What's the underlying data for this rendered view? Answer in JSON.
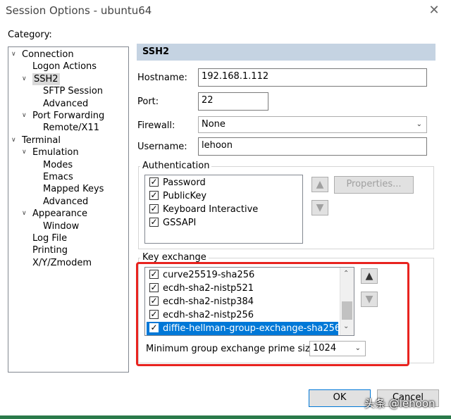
{
  "window": {
    "title": "Session Options - ubuntu64",
    "close_glyph": "✕"
  },
  "category": {
    "label": "Category:",
    "items": [
      {
        "label": "Connection",
        "level": 0,
        "expanded": true
      },
      {
        "label": "Logon Actions",
        "level": 1
      },
      {
        "label": "SSH2",
        "level": 1,
        "expanded": true,
        "selected": true
      },
      {
        "label": "SFTP Session",
        "level": 2
      },
      {
        "label": "Advanced",
        "level": 2
      },
      {
        "label": "Port Forwarding",
        "level": 1,
        "expanded": true
      },
      {
        "label": "Remote/X11",
        "level": 2
      },
      {
        "label": "Terminal",
        "level": 0,
        "expanded": true
      },
      {
        "label": "Emulation",
        "level": 1,
        "expanded": true
      },
      {
        "label": "Modes",
        "level": 2
      },
      {
        "label": "Emacs",
        "level": 2
      },
      {
        "label": "Mapped Keys",
        "level": 2
      },
      {
        "label": "Advanced",
        "level": 2
      },
      {
        "label": "Appearance",
        "level": 1,
        "expanded": true
      },
      {
        "label": "Window",
        "level": 2
      },
      {
        "label": "Log File",
        "level": 1
      },
      {
        "label": "Printing",
        "level": 1
      },
      {
        "label": "X/Y/Zmodem",
        "level": 1
      }
    ]
  },
  "panel": {
    "header": "SSH2",
    "hostname": {
      "label": "Hostname:",
      "value": "192.168.1.112"
    },
    "port": {
      "label": "Port:",
      "value": "22"
    },
    "firewall": {
      "label": "Firewall:",
      "value": "None"
    },
    "username": {
      "label": "Username:",
      "value": "lehoon"
    },
    "authentication": {
      "title": "Authentication",
      "items": [
        {
          "label": "Password",
          "checked": true
        },
        {
          "label": "PublicKey",
          "checked": true
        },
        {
          "label": "Keyboard Interactive",
          "checked": true
        },
        {
          "label": "GSSAPI",
          "checked": true
        }
      ],
      "properties_button": "Properties..."
    },
    "key_exchange": {
      "title": "Key exchange",
      "items": [
        {
          "label": "curve25519-sha256",
          "checked": true
        },
        {
          "label": "ecdh-sha2-nistp521",
          "checked": true
        },
        {
          "label": "ecdh-sha2-nistp384",
          "checked": true
        },
        {
          "label": "ecdh-sha2-nistp256",
          "checked": true
        },
        {
          "label": "diffie-hellman-group-exchange-sha256",
          "checked": true,
          "selected": true
        }
      ],
      "min_prime_label": "Minimum group exchange prime size:",
      "min_prime_value": "1024"
    }
  },
  "buttons": {
    "ok": "OK",
    "cancel": "Cancel"
  },
  "watermark": "头条 @lehoon",
  "colors": {
    "header_bg": "#c5d3e2",
    "selection": "#0078d7",
    "highlight_box": "#e8231f"
  }
}
